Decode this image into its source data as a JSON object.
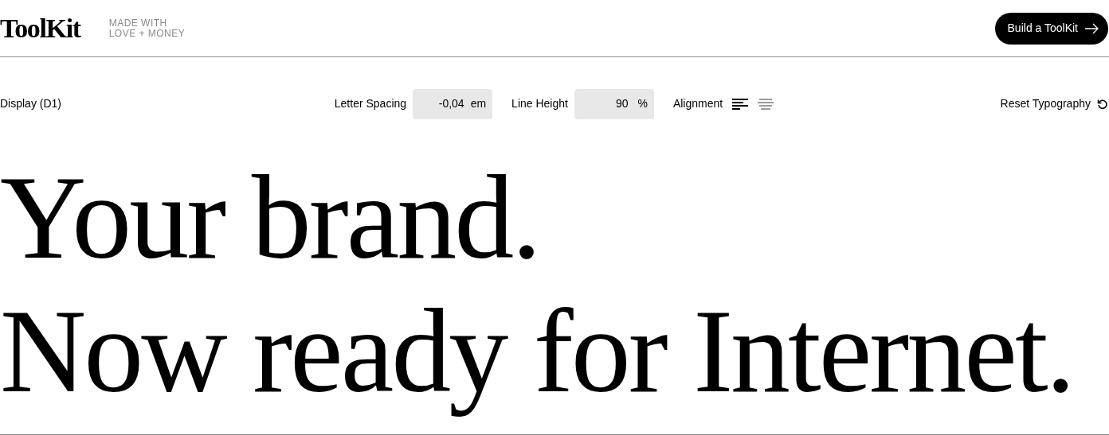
{
  "header": {
    "logo": "ToolKit",
    "tagline": [
      "MADE WITH",
      "LOVE + MONEY"
    ],
    "cta": "Build a ToolKit"
  },
  "controls": {
    "style_name": "Display (D1)",
    "letter_spacing": {
      "label": "Letter Spacing",
      "value": "-0,04",
      "unit": "em"
    },
    "line_height": {
      "label": "Line Height",
      "value": "90",
      "unit": "%"
    },
    "alignment": {
      "label": "Alignment",
      "options": [
        {
          "kind": "left",
          "selected": true
        },
        {
          "kind": "center",
          "selected": false
        }
      ]
    },
    "reset": "Reset Typography"
  },
  "preview": {
    "lines": [
      "Your brand.",
      "Now ready for Internet."
    ]
  }
}
